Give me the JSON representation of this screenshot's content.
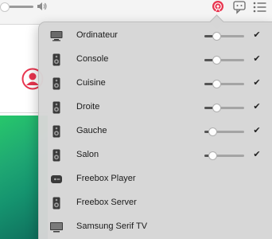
{
  "airplay": {
    "devices": [
      {
        "name": "Ordinateur",
        "icon": "computer-icon",
        "volume": 0.3,
        "checked": true,
        "show_volume": true
      },
      {
        "name": "Console",
        "icon": "speaker-icon",
        "volume": 0.3,
        "checked": true,
        "show_volume": true
      },
      {
        "name": "Cuisine",
        "icon": "speaker-icon",
        "volume": 0.3,
        "checked": true,
        "show_volume": true
      },
      {
        "name": "Droite",
        "icon": "speaker-icon",
        "volume": 0.3,
        "checked": true,
        "show_volume": true
      },
      {
        "name": "Gauche",
        "icon": "speaker-icon",
        "volume": 0.2,
        "checked": true,
        "show_volume": true
      },
      {
        "name": "Salon",
        "icon": "speaker-icon",
        "volume": 0.2,
        "checked": true,
        "show_volume": true
      },
      {
        "name": "Freebox Player",
        "icon": "apple-tv-icon",
        "volume": null,
        "checked": false,
        "show_volume": false
      },
      {
        "name": "Freebox Server",
        "icon": "speaker-icon",
        "volume": null,
        "checked": false,
        "show_volume": false
      },
      {
        "name": "Samsung Serif TV",
        "icon": "tv-icon",
        "volume": null,
        "checked": false,
        "show_volume": false
      }
    ]
  },
  "colors": {
    "airplay_active": "#e8344e",
    "profile": "#e8344e"
  },
  "toolbar": {
    "volume_level": 0.0
  }
}
